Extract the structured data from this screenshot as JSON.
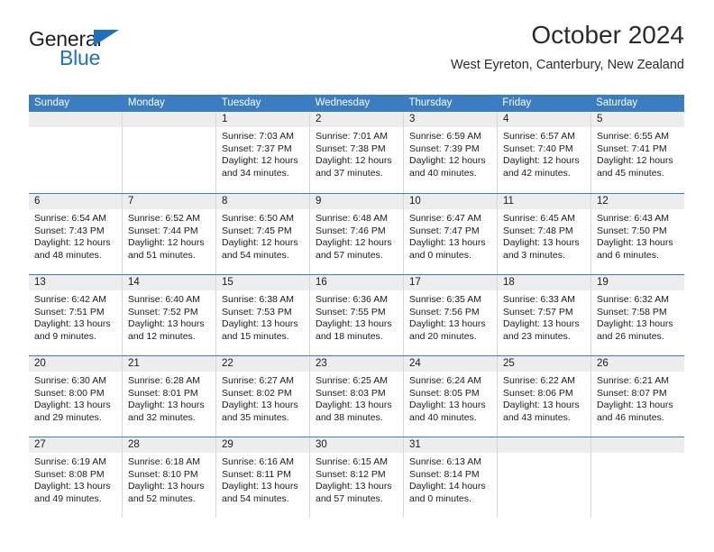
{
  "brand": {
    "name_part1": "General",
    "name_part2": "Blue"
  },
  "header": {
    "title": "October 2024",
    "location": "West Eyreton, Canterbury, New Zealand"
  },
  "colors": {
    "header_blue": "#3a7dc0",
    "brand_blue": "#1e72bb",
    "day_strip_gray": "#ededed",
    "cell_border": "#d8d8d8"
  },
  "weekdays": [
    "Sunday",
    "Monday",
    "Tuesday",
    "Wednesday",
    "Thursday",
    "Friday",
    "Saturday"
  ],
  "weeks": [
    [
      {
        "day": "",
        "empty": true
      },
      {
        "day": "",
        "empty": true
      },
      {
        "day": "1",
        "sunrise": "Sunrise: 7:03 AM",
        "sunset": "Sunset: 7:37 PM",
        "daylight": "Daylight: 12 hours and 34 minutes."
      },
      {
        "day": "2",
        "sunrise": "Sunrise: 7:01 AM",
        "sunset": "Sunset: 7:38 PM",
        "daylight": "Daylight: 12 hours and 37 minutes."
      },
      {
        "day": "3",
        "sunrise": "Sunrise: 6:59 AM",
        "sunset": "Sunset: 7:39 PM",
        "daylight": "Daylight: 12 hours and 40 minutes."
      },
      {
        "day": "4",
        "sunrise": "Sunrise: 6:57 AM",
        "sunset": "Sunset: 7:40 PM",
        "daylight": "Daylight: 12 hours and 42 minutes."
      },
      {
        "day": "5",
        "sunrise": "Sunrise: 6:55 AM",
        "sunset": "Sunset: 7:41 PM",
        "daylight": "Daylight: 12 hours and 45 minutes."
      }
    ],
    [
      {
        "day": "6",
        "sunrise": "Sunrise: 6:54 AM",
        "sunset": "Sunset: 7:43 PM",
        "daylight": "Daylight: 12 hours and 48 minutes."
      },
      {
        "day": "7",
        "sunrise": "Sunrise: 6:52 AM",
        "sunset": "Sunset: 7:44 PM",
        "daylight": "Daylight: 12 hours and 51 minutes."
      },
      {
        "day": "8",
        "sunrise": "Sunrise: 6:50 AM",
        "sunset": "Sunset: 7:45 PM",
        "daylight": "Daylight: 12 hours and 54 minutes."
      },
      {
        "day": "9",
        "sunrise": "Sunrise: 6:48 AM",
        "sunset": "Sunset: 7:46 PM",
        "daylight": "Daylight: 12 hours and 57 minutes."
      },
      {
        "day": "10",
        "sunrise": "Sunrise: 6:47 AM",
        "sunset": "Sunset: 7:47 PM",
        "daylight": "Daylight: 13 hours and 0 minutes."
      },
      {
        "day": "11",
        "sunrise": "Sunrise: 6:45 AM",
        "sunset": "Sunset: 7:48 PM",
        "daylight": "Daylight: 13 hours and 3 minutes."
      },
      {
        "day": "12",
        "sunrise": "Sunrise: 6:43 AM",
        "sunset": "Sunset: 7:50 PM",
        "daylight": "Daylight: 13 hours and 6 minutes."
      }
    ],
    [
      {
        "day": "13",
        "sunrise": "Sunrise: 6:42 AM",
        "sunset": "Sunset: 7:51 PM",
        "daylight": "Daylight: 13 hours and 9 minutes."
      },
      {
        "day": "14",
        "sunrise": "Sunrise: 6:40 AM",
        "sunset": "Sunset: 7:52 PM",
        "daylight": "Daylight: 13 hours and 12 minutes."
      },
      {
        "day": "15",
        "sunrise": "Sunrise: 6:38 AM",
        "sunset": "Sunset: 7:53 PM",
        "daylight": "Daylight: 13 hours and 15 minutes."
      },
      {
        "day": "16",
        "sunrise": "Sunrise: 6:36 AM",
        "sunset": "Sunset: 7:55 PM",
        "daylight": "Daylight: 13 hours and 18 minutes."
      },
      {
        "day": "17",
        "sunrise": "Sunrise: 6:35 AM",
        "sunset": "Sunset: 7:56 PM",
        "daylight": "Daylight: 13 hours and 20 minutes."
      },
      {
        "day": "18",
        "sunrise": "Sunrise: 6:33 AM",
        "sunset": "Sunset: 7:57 PM",
        "daylight": "Daylight: 13 hours and 23 minutes."
      },
      {
        "day": "19",
        "sunrise": "Sunrise: 6:32 AM",
        "sunset": "Sunset: 7:58 PM",
        "daylight": "Daylight: 13 hours and 26 minutes."
      }
    ],
    [
      {
        "day": "20",
        "sunrise": "Sunrise: 6:30 AM",
        "sunset": "Sunset: 8:00 PM",
        "daylight": "Daylight: 13 hours and 29 minutes."
      },
      {
        "day": "21",
        "sunrise": "Sunrise: 6:28 AM",
        "sunset": "Sunset: 8:01 PM",
        "daylight": "Daylight: 13 hours and 32 minutes."
      },
      {
        "day": "22",
        "sunrise": "Sunrise: 6:27 AM",
        "sunset": "Sunset: 8:02 PM",
        "daylight": "Daylight: 13 hours and 35 minutes."
      },
      {
        "day": "23",
        "sunrise": "Sunrise: 6:25 AM",
        "sunset": "Sunset: 8:03 PM",
        "daylight": "Daylight: 13 hours and 38 minutes."
      },
      {
        "day": "24",
        "sunrise": "Sunrise: 6:24 AM",
        "sunset": "Sunset: 8:05 PM",
        "daylight": "Daylight: 13 hours and 40 minutes."
      },
      {
        "day": "25",
        "sunrise": "Sunrise: 6:22 AM",
        "sunset": "Sunset: 8:06 PM",
        "daylight": "Daylight: 13 hours and 43 minutes."
      },
      {
        "day": "26",
        "sunrise": "Sunrise: 6:21 AM",
        "sunset": "Sunset: 8:07 PM",
        "daylight": "Daylight: 13 hours and 46 minutes."
      }
    ],
    [
      {
        "day": "27",
        "sunrise": "Sunrise: 6:19 AM",
        "sunset": "Sunset: 8:08 PM",
        "daylight": "Daylight: 13 hours and 49 minutes."
      },
      {
        "day": "28",
        "sunrise": "Sunrise: 6:18 AM",
        "sunset": "Sunset: 8:10 PM",
        "daylight": "Daylight: 13 hours and 52 minutes."
      },
      {
        "day": "29",
        "sunrise": "Sunrise: 6:16 AM",
        "sunset": "Sunset: 8:11 PM",
        "daylight": "Daylight: 13 hours and 54 minutes."
      },
      {
        "day": "30",
        "sunrise": "Sunrise: 6:15 AM",
        "sunset": "Sunset: 8:12 PM",
        "daylight": "Daylight: 13 hours and 57 minutes."
      },
      {
        "day": "31",
        "sunrise": "Sunrise: 6:13 AM",
        "sunset": "Sunset: 8:14 PM",
        "daylight": "Daylight: 14 hours and 0 minutes."
      },
      {
        "day": "",
        "empty": true
      },
      {
        "day": "",
        "empty": true
      }
    ]
  ]
}
